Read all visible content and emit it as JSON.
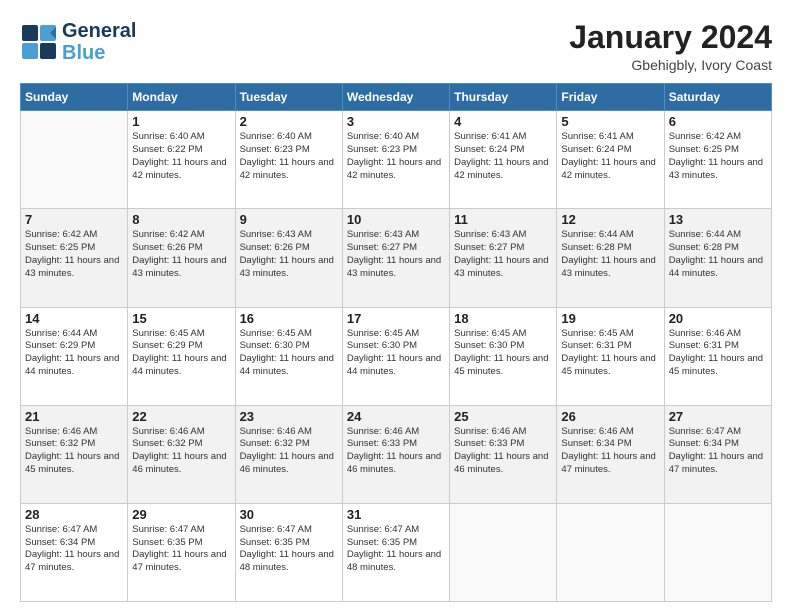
{
  "header": {
    "logo_line1": "General",
    "logo_line2": "Blue",
    "month_year": "January 2024",
    "location": "Gbehigbly, Ivory Coast"
  },
  "weekdays": [
    "Sunday",
    "Monday",
    "Tuesday",
    "Wednesday",
    "Thursday",
    "Friday",
    "Saturday"
  ],
  "weeks": [
    [
      {
        "day": "",
        "sunrise": "",
        "sunset": "",
        "daylight": ""
      },
      {
        "day": "1",
        "sunrise": "Sunrise: 6:40 AM",
        "sunset": "Sunset: 6:22 PM",
        "daylight": "Daylight: 11 hours and 42 minutes."
      },
      {
        "day": "2",
        "sunrise": "Sunrise: 6:40 AM",
        "sunset": "Sunset: 6:23 PM",
        "daylight": "Daylight: 11 hours and 42 minutes."
      },
      {
        "day": "3",
        "sunrise": "Sunrise: 6:40 AM",
        "sunset": "Sunset: 6:23 PM",
        "daylight": "Daylight: 11 hours and 42 minutes."
      },
      {
        "day": "4",
        "sunrise": "Sunrise: 6:41 AM",
        "sunset": "Sunset: 6:24 PM",
        "daylight": "Daylight: 11 hours and 42 minutes."
      },
      {
        "day": "5",
        "sunrise": "Sunrise: 6:41 AM",
        "sunset": "Sunset: 6:24 PM",
        "daylight": "Daylight: 11 hours and 42 minutes."
      },
      {
        "day": "6",
        "sunrise": "Sunrise: 6:42 AM",
        "sunset": "Sunset: 6:25 PM",
        "daylight": "Daylight: 11 hours and 43 minutes."
      }
    ],
    [
      {
        "day": "7",
        "sunrise": "Sunrise: 6:42 AM",
        "sunset": "Sunset: 6:25 PM",
        "daylight": "Daylight: 11 hours and 43 minutes."
      },
      {
        "day": "8",
        "sunrise": "Sunrise: 6:42 AM",
        "sunset": "Sunset: 6:26 PM",
        "daylight": "Daylight: 11 hours and 43 minutes."
      },
      {
        "day": "9",
        "sunrise": "Sunrise: 6:43 AM",
        "sunset": "Sunset: 6:26 PM",
        "daylight": "Daylight: 11 hours and 43 minutes."
      },
      {
        "day": "10",
        "sunrise": "Sunrise: 6:43 AM",
        "sunset": "Sunset: 6:27 PM",
        "daylight": "Daylight: 11 hours and 43 minutes."
      },
      {
        "day": "11",
        "sunrise": "Sunrise: 6:43 AM",
        "sunset": "Sunset: 6:27 PM",
        "daylight": "Daylight: 11 hours and 43 minutes."
      },
      {
        "day": "12",
        "sunrise": "Sunrise: 6:44 AM",
        "sunset": "Sunset: 6:28 PM",
        "daylight": "Daylight: 11 hours and 43 minutes."
      },
      {
        "day": "13",
        "sunrise": "Sunrise: 6:44 AM",
        "sunset": "Sunset: 6:28 PM",
        "daylight": "Daylight: 11 hours and 44 minutes."
      }
    ],
    [
      {
        "day": "14",
        "sunrise": "Sunrise: 6:44 AM",
        "sunset": "Sunset: 6:29 PM",
        "daylight": "Daylight: 11 hours and 44 minutes."
      },
      {
        "day": "15",
        "sunrise": "Sunrise: 6:45 AM",
        "sunset": "Sunset: 6:29 PM",
        "daylight": "Daylight: 11 hours and 44 minutes."
      },
      {
        "day": "16",
        "sunrise": "Sunrise: 6:45 AM",
        "sunset": "Sunset: 6:30 PM",
        "daylight": "Daylight: 11 hours and 44 minutes."
      },
      {
        "day": "17",
        "sunrise": "Sunrise: 6:45 AM",
        "sunset": "Sunset: 6:30 PM",
        "daylight": "Daylight: 11 hours and 44 minutes."
      },
      {
        "day": "18",
        "sunrise": "Sunrise: 6:45 AM",
        "sunset": "Sunset: 6:30 PM",
        "daylight": "Daylight: 11 hours and 45 minutes."
      },
      {
        "day": "19",
        "sunrise": "Sunrise: 6:45 AM",
        "sunset": "Sunset: 6:31 PM",
        "daylight": "Daylight: 11 hours and 45 minutes."
      },
      {
        "day": "20",
        "sunrise": "Sunrise: 6:46 AM",
        "sunset": "Sunset: 6:31 PM",
        "daylight": "Daylight: 11 hours and 45 minutes."
      }
    ],
    [
      {
        "day": "21",
        "sunrise": "Sunrise: 6:46 AM",
        "sunset": "Sunset: 6:32 PM",
        "daylight": "Daylight: 11 hours and 45 minutes."
      },
      {
        "day": "22",
        "sunrise": "Sunrise: 6:46 AM",
        "sunset": "Sunset: 6:32 PM",
        "daylight": "Daylight: 11 hours and 46 minutes."
      },
      {
        "day": "23",
        "sunrise": "Sunrise: 6:46 AM",
        "sunset": "Sunset: 6:32 PM",
        "daylight": "Daylight: 11 hours and 46 minutes."
      },
      {
        "day": "24",
        "sunrise": "Sunrise: 6:46 AM",
        "sunset": "Sunset: 6:33 PM",
        "daylight": "Daylight: 11 hours and 46 minutes."
      },
      {
        "day": "25",
        "sunrise": "Sunrise: 6:46 AM",
        "sunset": "Sunset: 6:33 PM",
        "daylight": "Daylight: 11 hours and 46 minutes."
      },
      {
        "day": "26",
        "sunrise": "Sunrise: 6:46 AM",
        "sunset": "Sunset: 6:34 PM",
        "daylight": "Daylight: 11 hours and 47 minutes."
      },
      {
        "day": "27",
        "sunrise": "Sunrise: 6:47 AM",
        "sunset": "Sunset: 6:34 PM",
        "daylight": "Daylight: 11 hours and 47 minutes."
      }
    ],
    [
      {
        "day": "28",
        "sunrise": "Sunrise: 6:47 AM",
        "sunset": "Sunset: 6:34 PM",
        "daylight": "Daylight: 11 hours and 47 minutes."
      },
      {
        "day": "29",
        "sunrise": "Sunrise: 6:47 AM",
        "sunset": "Sunset: 6:35 PM",
        "daylight": "Daylight: 11 hours and 47 minutes."
      },
      {
        "day": "30",
        "sunrise": "Sunrise: 6:47 AM",
        "sunset": "Sunset: 6:35 PM",
        "daylight": "Daylight: 11 hours and 48 minutes."
      },
      {
        "day": "31",
        "sunrise": "Sunrise: 6:47 AM",
        "sunset": "Sunset: 6:35 PM",
        "daylight": "Daylight: 11 hours and 48 minutes."
      },
      {
        "day": "",
        "sunrise": "",
        "sunset": "",
        "daylight": ""
      },
      {
        "day": "",
        "sunrise": "",
        "sunset": "",
        "daylight": ""
      },
      {
        "day": "",
        "sunrise": "",
        "sunset": "",
        "daylight": ""
      }
    ]
  ]
}
